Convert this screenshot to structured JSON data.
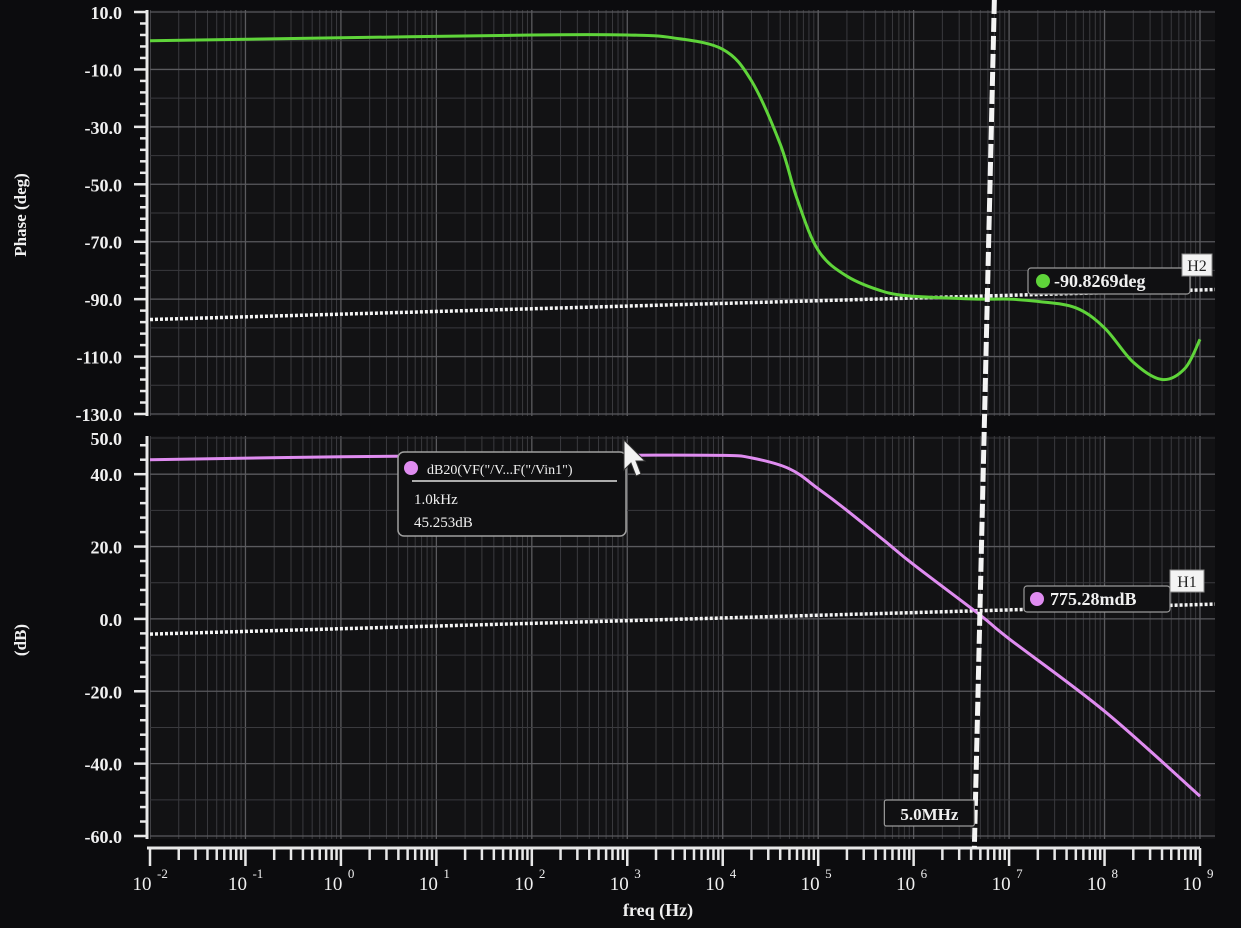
{
  "chart_data": [
    {
      "type": "line",
      "title": "",
      "xlabel": "freq (Hz)",
      "ylabel": "Phase (deg)",
      "xscale": "log",
      "xlim": [
        0.01,
        1000000000
      ],
      "ylim": [
        -130,
        10
      ],
      "ytick_labels": [
        "10.0",
        "-10.0",
        "-30.0",
        "-50.0",
        "-70.0",
        "-90.0",
        "-110.0",
        "-130.0"
      ],
      "grid": true,
      "series": [
        {
          "color": "#5fd43a",
          "x": [
            0.01,
            1,
            100,
            1000,
            3000,
            10000,
            20000,
            40000,
            60000,
            100000,
            200000,
            500000,
            1000000,
            2000000,
            5000000,
            10000000,
            20000000,
            50000000,
            100000000,
            200000000,
            400000000,
            700000000,
            1000000000
          ],
          "y": [
            0,
            1,
            2,
            2,
            1,
            -3,
            -14,
            -36,
            -55,
            -73,
            -82,
            -87.5,
            -89,
            -89.5,
            -90,
            -90,
            -90.8,
            -93,
            -100,
            -112,
            -118,
            -114,
            -104
          ]
        }
      ],
      "markers": [
        {
          "label": "H2",
          "value_text": "-90.8269deg",
          "y": -90.83,
          "color": "#5fd43a"
        }
      ]
    },
    {
      "type": "line",
      "title": "",
      "xlabel": "freq (Hz)",
      "ylabel": "(dB)",
      "xscale": "log",
      "xlim": [
        0.01,
        1000000000
      ],
      "ylim": [
        -60,
        50
      ],
      "ytick_labels": [
        "50.0",
        "40.0",
        "20.0",
        "0.0",
        "-20.0",
        "-40.0",
        "-60.0"
      ],
      "grid": true,
      "series": [
        {
          "name": "dB20(VF(\"/V...F(\"/Vin1\")",
          "color": "#df8cf0",
          "x": [
            0.01,
            1,
            100,
            1000,
            10000,
            20000,
            50000,
            100000,
            200000,
            500000,
            1000000,
            5000000,
            10000000,
            100000000,
            1000000000
          ],
          "y": [
            44,
            44.8,
            45.2,
            45.25,
            45.2,
            44.5,
            41.5,
            36,
            30,
            21.5,
            15,
            1,
            -5.5,
            -25.5,
            -49
          ]
        }
      ],
      "markers": [
        {
          "label": "H1",
          "value_text": "775.28mdB",
          "y": 0.775,
          "color": "#df8cf0"
        }
      ],
      "tooltip": {
        "series": "dB20(VF(\"/V...F(\"/Vin1\")",
        "x_text": "1.0kHz",
        "y_text": "45.253dB"
      }
    }
  ],
  "x_axis": {
    "label": "freq (Hz)",
    "tick_exponents": [
      "-2",
      "-1",
      "0",
      "1",
      "2",
      "3",
      "4",
      "5",
      "6",
      "7",
      "8",
      "9"
    ],
    "tick_base": "10"
  },
  "vertical_marker": {
    "x": 5000000,
    "label": "5.0MHz"
  }
}
